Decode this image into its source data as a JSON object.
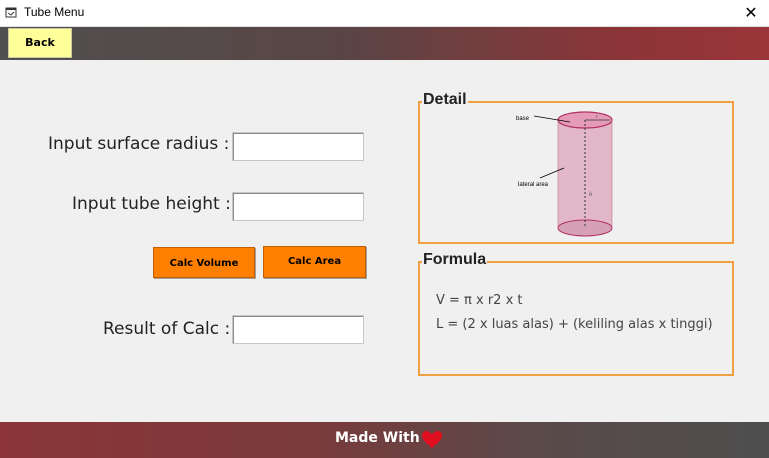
{
  "window": {
    "title": "Tube Menu",
    "close_glyph": "✕"
  },
  "toolbar": {
    "back_label": "Back"
  },
  "form": {
    "radius_label": "Input surface radius  :",
    "radius_value": "",
    "height_label": "Input tube height :",
    "height_value": "",
    "calc_volume_label": "Calc Volume",
    "calc_area_label": "Calc Area",
    "result_label": "Result of Calc :",
    "result_value": ""
  },
  "detail": {
    "title": "Detail",
    "diagram": {
      "base_label": "base",
      "lateral_label": "lateral area",
      "r_label": "r",
      "h_label": "h"
    }
  },
  "formula": {
    "title": "Formula",
    "volume": "V = π x r2 x t",
    "area": "L = (2 x luas alas) + (keliling alas x tinggi)"
  },
  "footer": {
    "text": "Made With",
    "icon": "heart-icon"
  },
  "colors": {
    "accent_orange": "#ff8000",
    "back_yellow": "#ffff99",
    "frame_orange": "#f0a040",
    "cylinder_pink": "#e8b4c8"
  }
}
